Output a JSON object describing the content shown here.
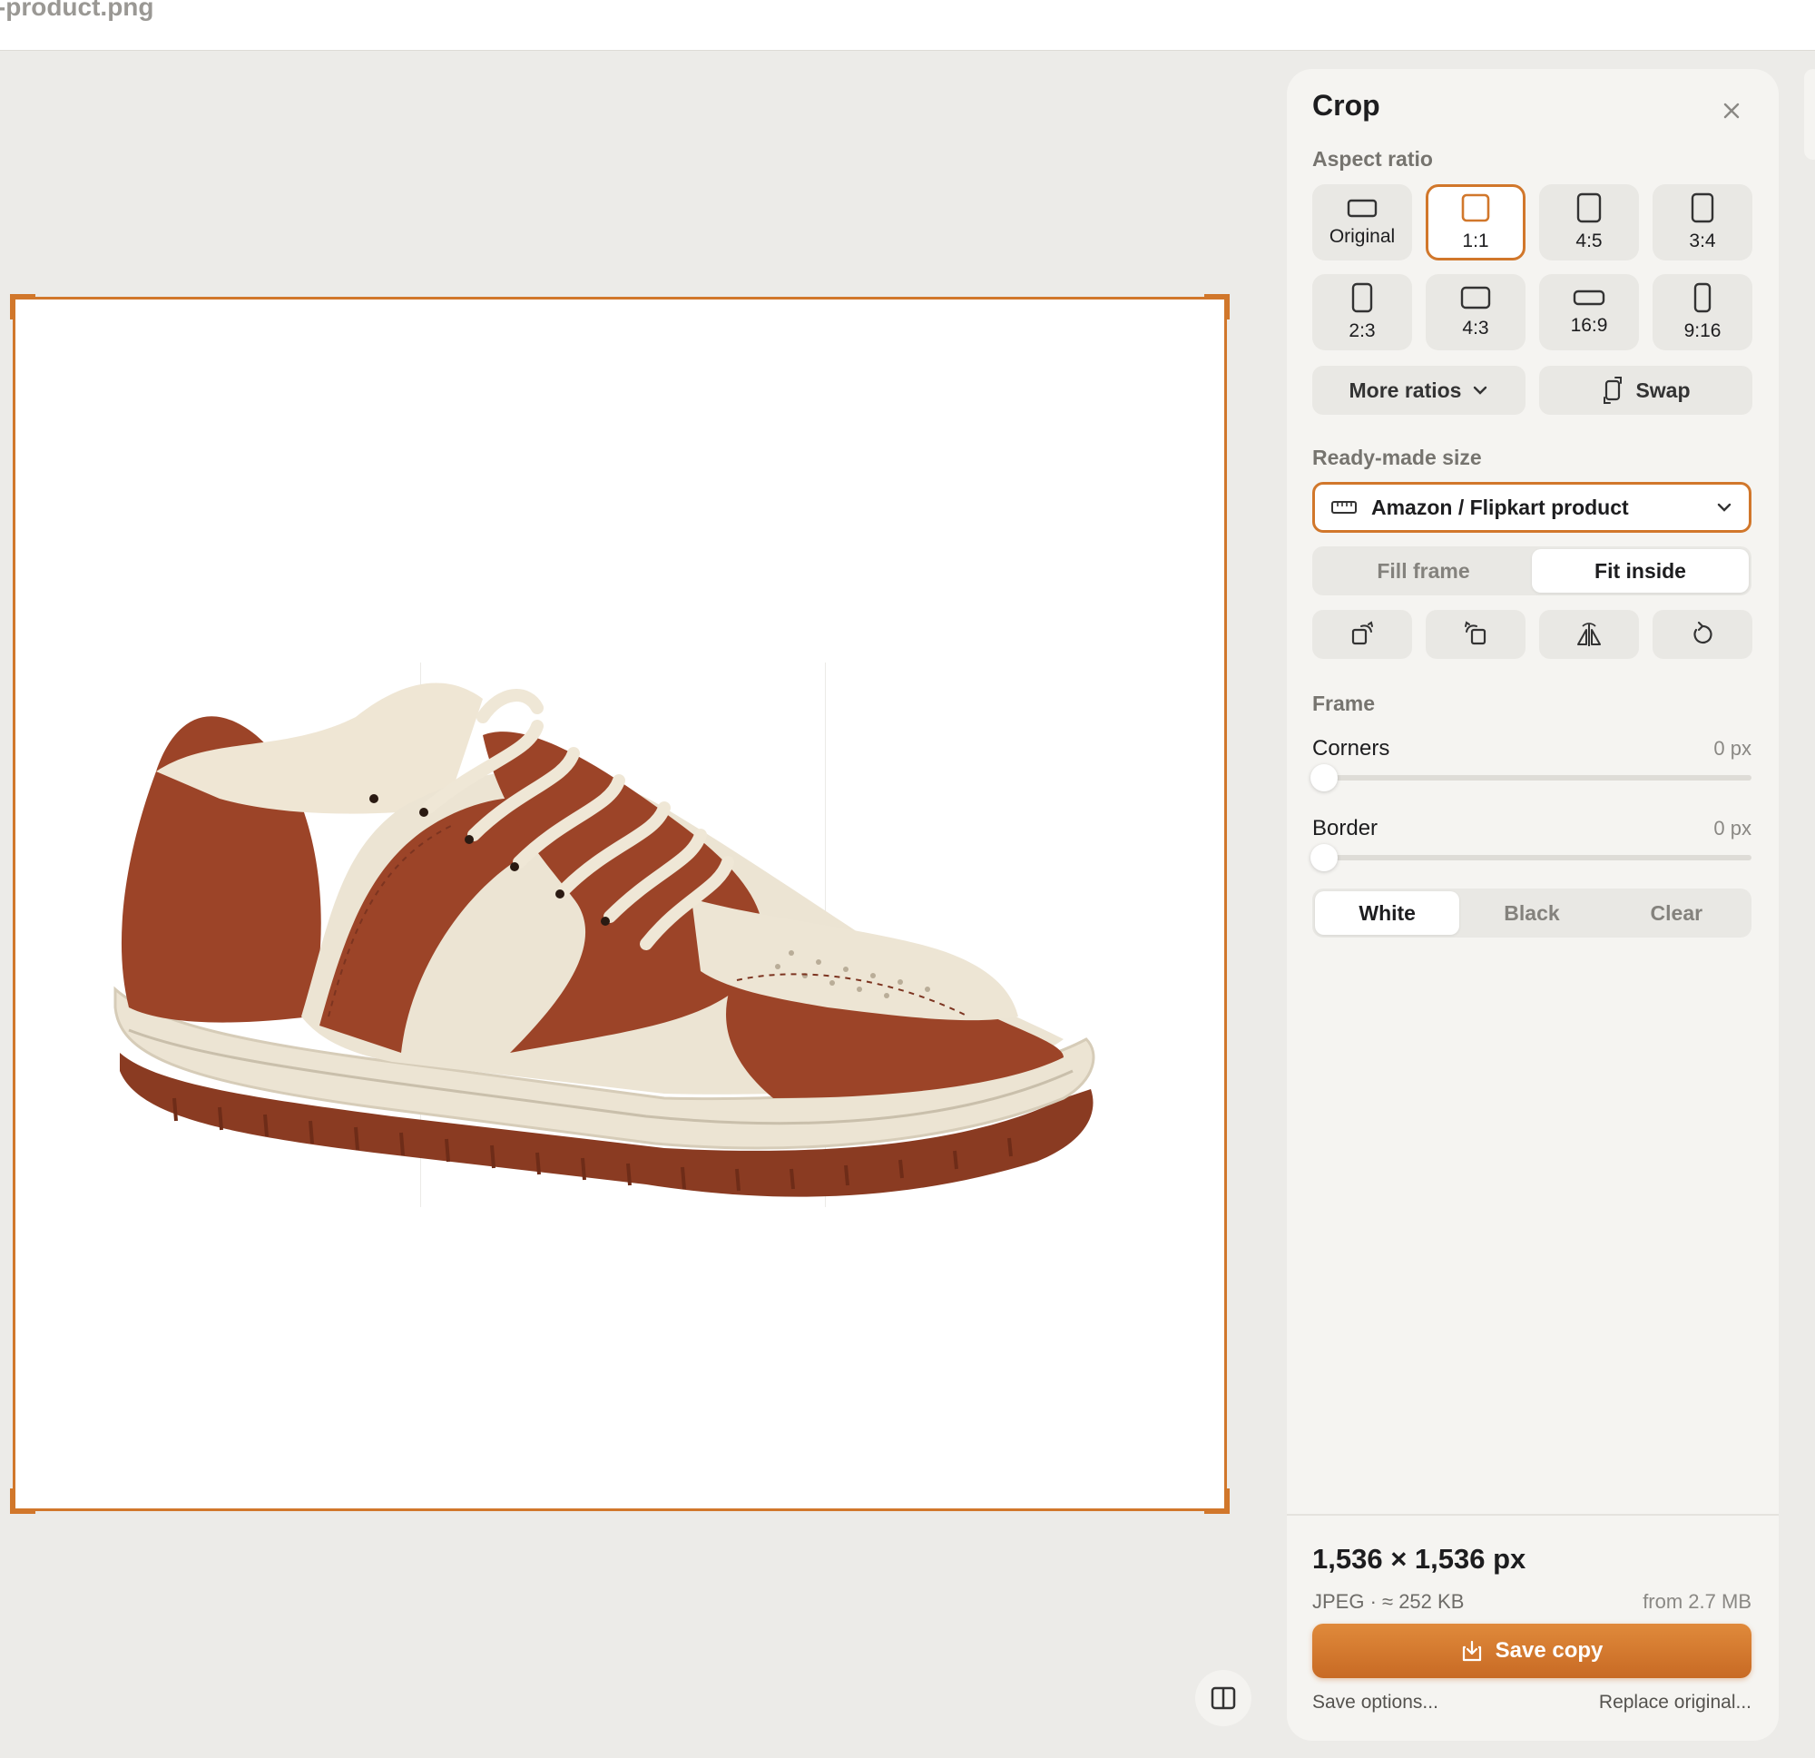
{
  "window": {
    "filename": "r-product.png"
  },
  "colors": {
    "accent": "#d1772b",
    "panel": "#f5f4f1",
    "canvas": "#ecebe8"
  },
  "panel": {
    "title": "Crop",
    "close_icon": "close-icon",
    "aspect_ratio": {
      "label": "Aspect ratio",
      "selected": "1:1",
      "options": [
        {
          "label": "Original"
        },
        {
          "label": "1:1"
        },
        {
          "label": "4:5"
        },
        {
          "label": "3:4"
        },
        {
          "label": "2:3"
        },
        {
          "label": "4:3"
        },
        {
          "label": "16:9"
        },
        {
          "label": "9:16"
        }
      ],
      "more_ratios": "More ratios",
      "swap": "Swap"
    },
    "ready_made": {
      "label": "Ready-made size",
      "selected": "Amazon / Flipkart product",
      "modes": [
        "Fill frame",
        "Fit inside"
      ],
      "active_mode": "Fit inside"
    },
    "tools": [
      "rotate-right-icon",
      "rotate-left-icon",
      "flip-horizontal-icon",
      "reset-icon"
    ],
    "frame": {
      "label": "Frame",
      "corners": {
        "label": "Corners",
        "value": "0 px",
        "level": 0
      },
      "border": {
        "label": "Border",
        "value": "0 px",
        "level": 0
      },
      "colors": [
        "White",
        "Black",
        "Clear"
      ],
      "active_color": "White"
    },
    "output": {
      "dimensions": "1,536 × 1,536 px",
      "format": "JPEG · ≈ 252 KB",
      "original_size": "from 2.7 MB",
      "save_label": "Save copy",
      "save_options": "Save options...",
      "replace_original": "Replace original..."
    }
  }
}
